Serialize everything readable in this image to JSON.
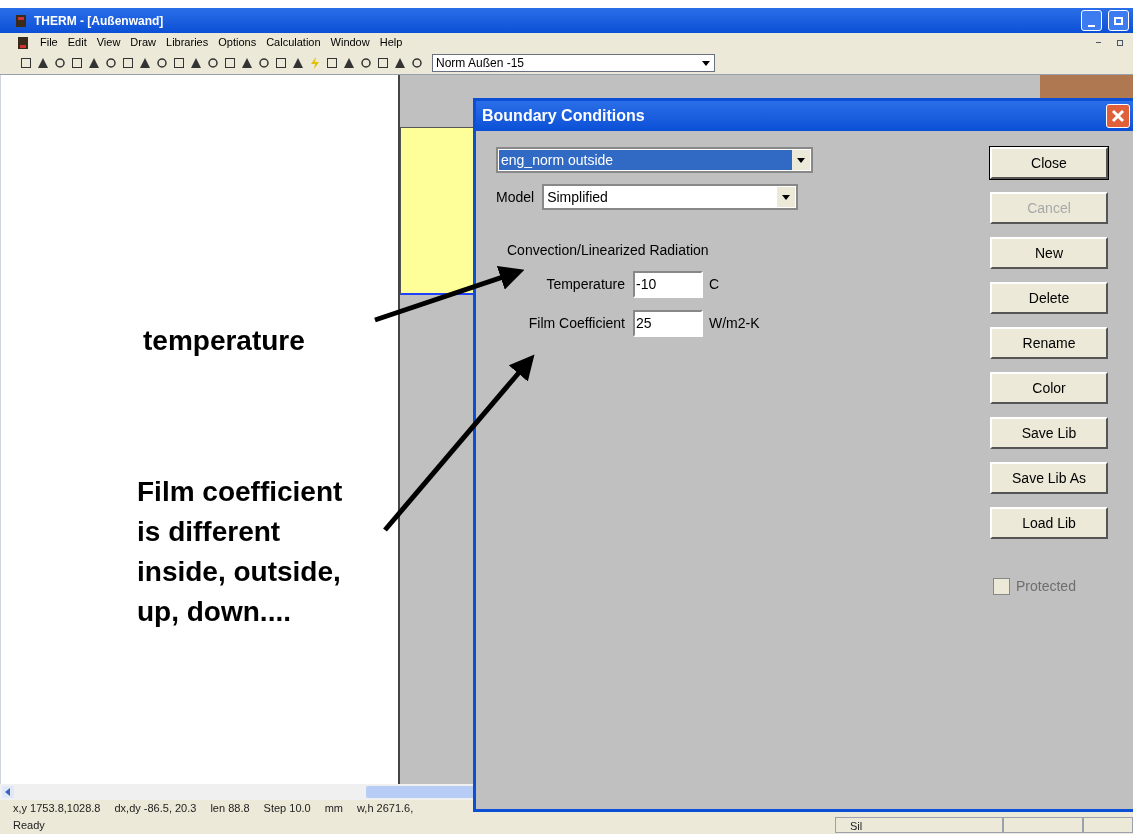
{
  "window": {
    "title": "THERM - [Außenwand]"
  },
  "menu": [
    "File",
    "Edit",
    "View",
    "Draw",
    "Libraries",
    "Options",
    "Calculation",
    "Window",
    "Help"
  ],
  "toolbar": {
    "dropdown_value": "Norm Außen -15"
  },
  "dialog": {
    "title": "Boundary Conditions",
    "condition": {
      "value": "eng_norm outside",
      "selected": true
    },
    "model": {
      "label": "Model",
      "value": "Simplified"
    },
    "section": "Convection/Linearized Radiation",
    "fields": [
      {
        "label": "Temperature",
        "value": "-10",
        "unit": "C"
      },
      {
        "label": "Film Coefficient",
        "value": "25",
        "unit": "W/m2-K"
      }
    ],
    "buttons": [
      {
        "label": "Close",
        "disabled": false
      },
      {
        "label": "Cancel",
        "disabled": true
      },
      {
        "label": "New",
        "disabled": false
      },
      {
        "label": "Delete",
        "disabled": false
      },
      {
        "label": "Rename",
        "disabled": false
      },
      {
        "label": "Color",
        "disabled": false
      },
      {
        "label": "Save Lib",
        "disabled": false
      },
      {
        "label": "Save Lib As",
        "disabled": false
      },
      {
        "label": "Load Lib",
        "disabled": false
      }
    ],
    "protected": {
      "label": "Protected",
      "checked": false,
      "disabled": true
    }
  },
  "annotations": [
    {
      "lines": [
        "temperature"
      ]
    },
    {
      "lines": [
        "Film coefficient",
        "is different",
        "inside, outside,",
        "up, down...."
      ]
    }
  ],
  "status_bar": {
    "fields": [
      "x,y 1753.8,1028.8",
      "dx,dy -86.5, 20.3",
      "len 88.8",
      "Step 10.0",
      "mm",
      "w,h 2671.6,"
    ],
    "message": "Ready",
    "panel": "Sil"
  }
}
